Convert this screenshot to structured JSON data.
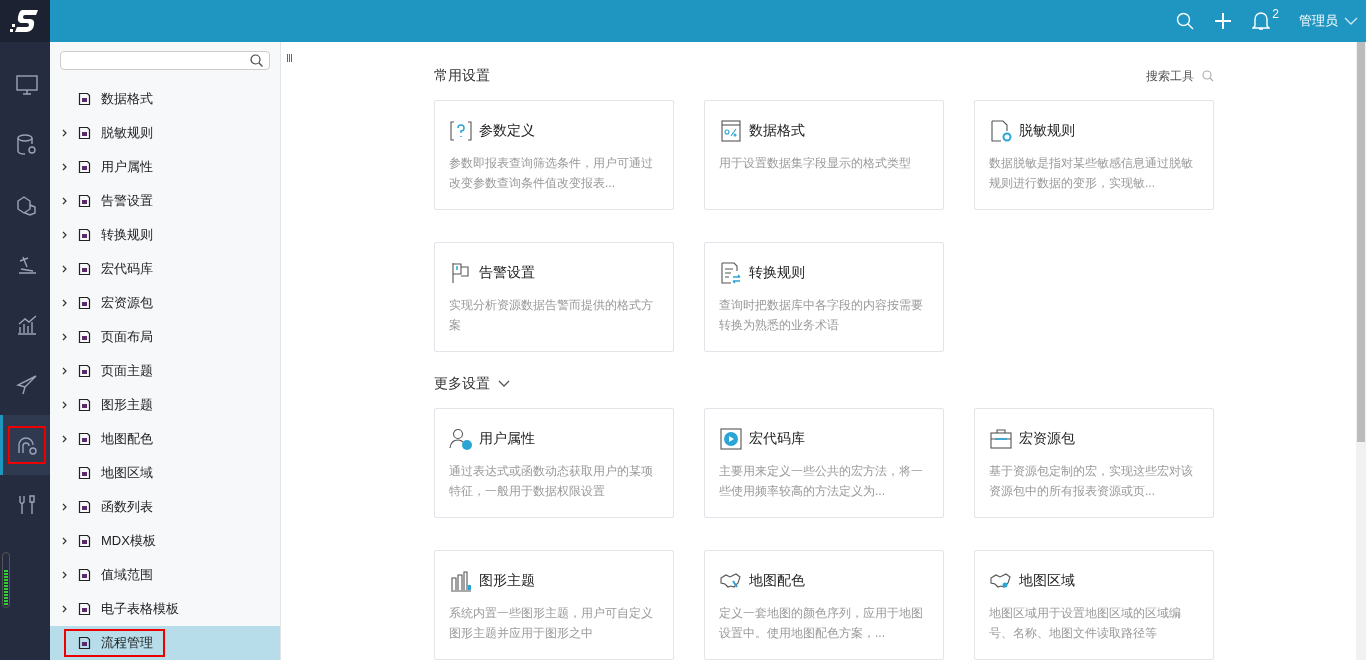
{
  "topbar": {
    "notification_count": "2",
    "user": "管理员"
  },
  "rail": [
    {
      "kind": "monitor",
      "selected": false,
      "highlighted": false
    },
    {
      "kind": "database",
      "selected": false,
      "highlighted": false
    },
    {
      "kind": "cubes",
      "selected": false,
      "highlighted": false
    },
    {
      "kind": "stamp",
      "selected": false,
      "highlighted": false
    },
    {
      "kind": "chart",
      "selected": false,
      "highlighted": false
    },
    {
      "kind": "plane",
      "selected": false,
      "highlighted": false
    },
    {
      "kind": "config",
      "selected": true,
      "highlighted": true
    },
    {
      "kind": "tools",
      "selected": false,
      "highlighted": false
    }
  ],
  "sidebar": {
    "items": [
      {
        "label": "数据格式",
        "expandable": false,
        "selected": false,
        "highlighted": false
      },
      {
        "label": "脱敏规则",
        "expandable": true,
        "selected": false,
        "highlighted": false
      },
      {
        "label": "用户属性",
        "expandable": true,
        "selected": false,
        "highlighted": false
      },
      {
        "label": "告警设置",
        "expandable": true,
        "selected": false,
        "highlighted": false
      },
      {
        "label": "转换规则",
        "expandable": true,
        "selected": false,
        "highlighted": false
      },
      {
        "label": "宏代码库",
        "expandable": true,
        "selected": false,
        "highlighted": false
      },
      {
        "label": "宏资源包",
        "expandable": true,
        "selected": false,
        "highlighted": false
      },
      {
        "label": "页面布局",
        "expandable": true,
        "selected": false,
        "highlighted": false
      },
      {
        "label": "页面主题",
        "expandable": true,
        "selected": false,
        "highlighted": false
      },
      {
        "label": "图形主题",
        "expandable": true,
        "selected": false,
        "highlighted": false
      },
      {
        "label": "地图配色",
        "expandable": true,
        "selected": false,
        "highlighted": false
      },
      {
        "label": "地图区域",
        "expandable": false,
        "selected": false,
        "highlighted": false
      },
      {
        "label": "函数列表",
        "expandable": true,
        "selected": false,
        "highlighted": false
      },
      {
        "label": "MDX模板",
        "expandable": true,
        "selected": false,
        "highlighted": false
      },
      {
        "label": "值域范围",
        "expandable": true,
        "selected": false,
        "highlighted": false
      },
      {
        "label": "电子表格模板",
        "expandable": true,
        "selected": false,
        "highlighted": false
      },
      {
        "label": "流程管理",
        "expandable": false,
        "selected": true,
        "highlighted": true
      }
    ]
  },
  "sections": [
    {
      "title": "常用设置",
      "search_tool": "搜索工具",
      "cards": [
        {
          "kind": "param",
          "title": "参数定义",
          "description": "参数即报表查询筛选条件，用户可通过改变参数查询条件值改变报表..."
        },
        {
          "kind": "format",
          "title": "数据格式",
          "description": "用于设置数据集字段显示的格式类型"
        },
        {
          "kind": "mask",
          "title": "脱敏规则",
          "description": "数据脱敏是指对某些敏感信息通过脱敏规则进行数据的变形，实现敏..."
        },
        {
          "kind": "alert",
          "title": "告警设置",
          "description": "实现分析资源数据告警而提供的格式方案"
        },
        {
          "kind": "convert",
          "title": "转换规则",
          "description": "查询时把数据库中各字段的内容按需要转换为熟悉的业务术语"
        }
      ]
    },
    {
      "title": "更多设置",
      "expanded": true,
      "cards": [
        {
          "kind": "user",
          "title": "用户属性",
          "description": "通过表达式或函数动态获取用户的某项特征，一般用于数据权限设置"
        },
        {
          "kind": "macro",
          "title": "宏代码库",
          "description": "主要用来定义一些公共的宏方法，将一些使用频率较高的方法定义为..."
        },
        {
          "kind": "package",
          "title": "宏资源包",
          "description": "基于资源包定制的宏，实现这些宏对该资源包中的所有报表资源或页..."
        },
        {
          "kind": "charttheme",
          "title": "图形主题",
          "description": "系统内置一些图形主题，用户可自定义图形主题并应用于图形之中"
        },
        {
          "kind": "mapcolor",
          "title": "地图配色",
          "description": "定义一套地图的颜色序列，应用于地图设置中。使用地图配色方案，..."
        },
        {
          "kind": "maparea",
          "title": "地图区域",
          "description": "地图区域用于设置地图区域的区域编号、名称、地图文件读取路径等"
        }
      ]
    }
  ]
}
